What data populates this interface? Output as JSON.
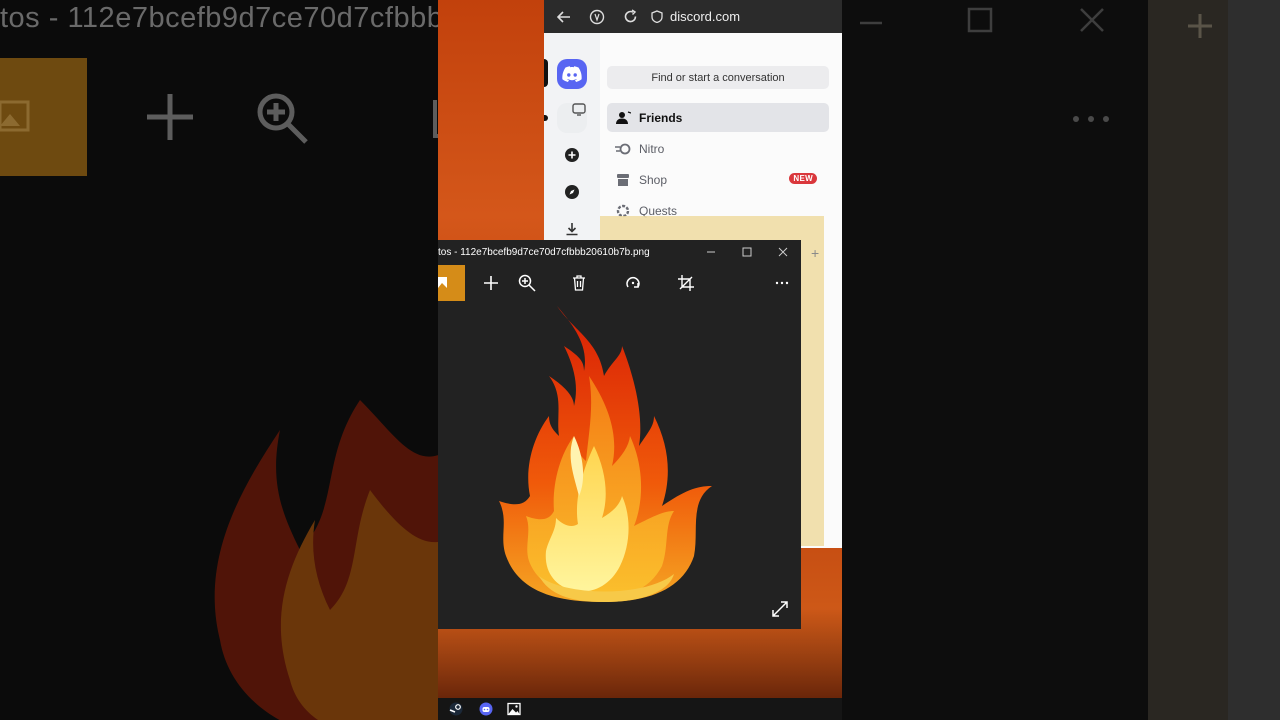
{
  "background": {
    "window_title": "tos - 112e7bcefb9d7ce70d7cfbbb"
  },
  "browser": {
    "url": "discord.com",
    "search_placeholder": "Find or start a conversation",
    "dm_items": [
      {
        "label": "Friends",
        "icon": "friends-icon",
        "active": true
      },
      {
        "label": "Nitro",
        "icon": "nitro-icon",
        "active": false
      },
      {
        "label": "Shop",
        "icon": "shop-icon",
        "active": false,
        "badge": "NEW"
      },
      {
        "label": "Quests",
        "icon": "quests-icon",
        "active": false
      }
    ]
  },
  "photos": {
    "title": "tos - 112e7bcefb9d7ce70d7cfbbb20610b7b.png",
    "toolbar_icons": [
      "add-icon",
      "zoom-in-icon",
      "delete-icon",
      "rotate-icon",
      "crop-icon",
      "more-icon"
    ]
  },
  "taskbar": {
    "apps": [
      "steam-icon",
      "discord-icon",
      "photos-icon"
    ]
  },
  "colors": {
    "discord_blurple": "#5865f2",
    "badge_red": "#da373c",
    "photos_accent": "#d58c18"
  }
}
